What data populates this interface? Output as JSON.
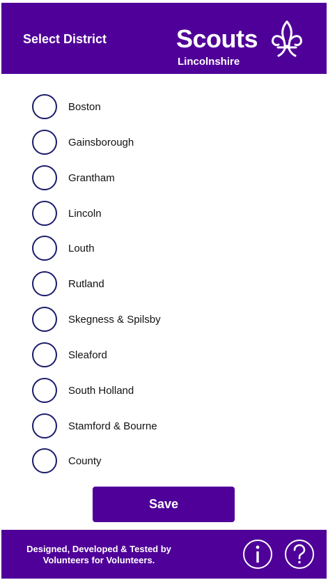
{
  "header": {
    "title": "Select District",
    "logo_word": "Scouts",
    "logo_sub": "Lincolnshire"
  },
  "districts": [
    {
      "label": "Boston",
      "selected": false
    },
    {
      "label": "Gainsborough",
      "selected": false
    },
    {
      "label": "Grantham",
      "selected": false
    },
    {
      "label": "Lincoln",
      "selected": false
    },
    {
      "label": "Louth",
      "selected": false
    },
    {
      "label": "Rutland",
      "selected": false
    },
    {
      "label": "Skegness & Spilsby",
      "selected": false
    },
    {
      "label": "Sleaford",
      "selected": false
    },
    {
      "label": "South Holland",
      "selected": false
    },
    {
      "label": "Stamford & Bourne",
      "selected": false
    },
    {
      "label": "County",
      "selected": false
    }
  ],
  "save_label": "Save",
  "footer": {
    "line1": "Designed, Developed & Tested by",
    "line2": "Volunteers for Volunteers.",
    "info_icon": "info-icon",
    "help_icon": "help-icon"
  },
  "colors": {
    "brand_purple": "#4f0098",
    "radio_border": "#1a1a6a"
  }
}
